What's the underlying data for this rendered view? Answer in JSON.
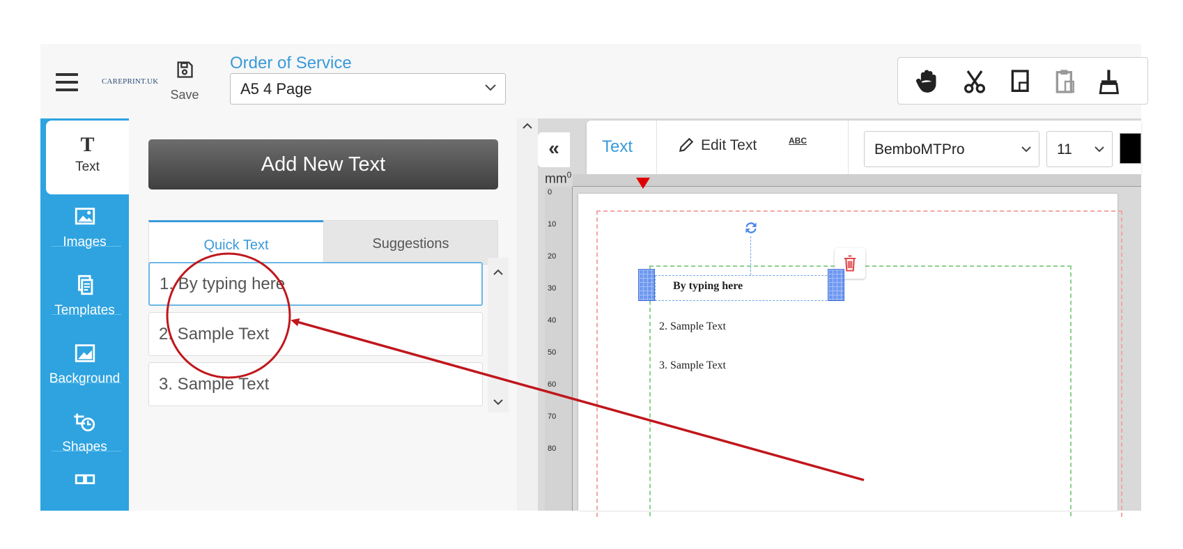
{
  "header": {
    "brand_logo": "CAREPRINT.UK",
    "save_label": "Save",
    "doc_title": "Order of Service",
    "doc_format": "A5 4 Page",
    "tools": [
      "hand-icon",
      "cut-icon",
      "copy-icon",
      "paste-icon",
      "format-painter-icon"
    ]
  },
  "sidebar": {
    "items": [
      {
        "label": "Text",
        "icon": "text-icon"
      },
      {
        "label": "Images",
        "icon": "image-icon"
      },
      {
        "label": "Templates",
        "icon": "templates-icon"
      },
      {
        "label": "Background",
        "icon": "background-icon"
      },
      {
        "label": "Shapes",
        "icon": "shapes-icon"
      }
    ]
  },
  "panel": {
    "add_button": "Add New Text",
    "tabs": [
      {
        "label": "Quick Text",
        "active": true
      },
      {
        "label": "Suggestions",
        "active": false
      }
    ],
    "quick_text": [
      "1. By typing here",
      "2. Sample Text",
      "3. Sample Text"
    ]
  },
  "text_toolbar": {
    "mode": "Text",
    "edit_label": "Edit Text",
    "spell_label": "ABC",
    "font": "BemboMTPro",
    "size": "11",
    "color": "#000000"
  },
  "canvas": {
    "unit": "mm",
    "hruler_start": "0",
    "vruler_ticks": [
      "0",
      "10",
      "20",
      "30",
      "40",
      "50",
      "60",
      "70",
      "80"
    ],
    "page_texts": [
      "By typing here",
      "2. Sample Text",
      "3. Sample Text"
    ]
  },
  "colors": {
    "accent": "#3a9ad9",
    "rail": "#2ea3e0",
    "annotation": "#c0161c"
  }
}
